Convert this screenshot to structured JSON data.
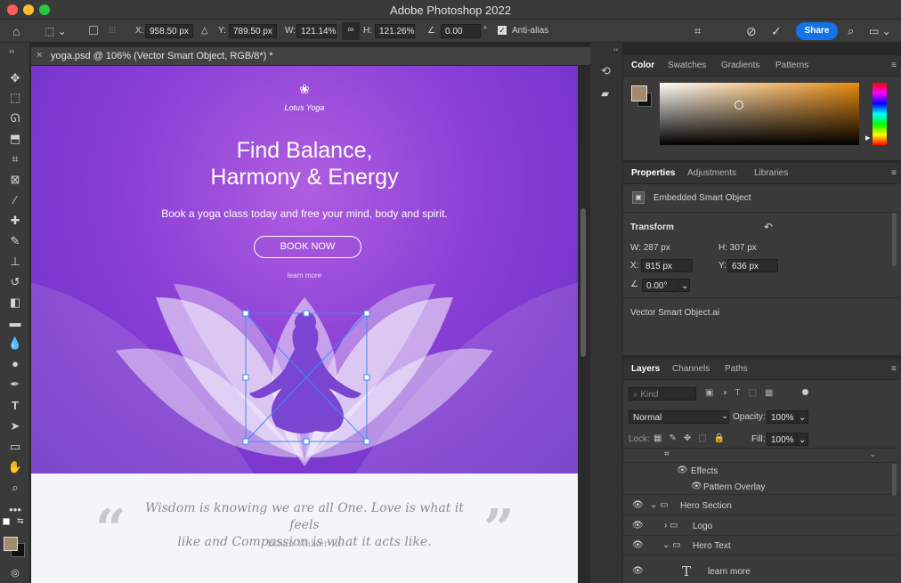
{
  "app": {
    "title": "Adobe Photoshop 2022"
  },
  "options": {
    "x_label": "X:",
    "x_value": "958.50 px",
    "y_label": "Y:",
    "y_value": "789.50 px",
    "w_label": "W:",
    "w_value": "121.14%",
    "h_label": "H:",
    "h_value": "121.26%",
    "angle_value": "0.00",
    "angle_unit": "°",
    "antialias_label": "Anti-alias",
    "share_label": "Share"
  },
  "document": {
    "tab_title": "yoga.psd @ 106% (Vector Smart Object, RGB/8*) *"
  },
  "canvas": {
    "logo_name": "Lotus Yoga",
    "heading_line1": "Find Balance,",
    "heading_line2": "Harmony & Energy",
    "subheading": "Book a yoga class today and free your mind, body and spirit.",
    "cta": "BOOK NOW",
    "learn_more": "learn more",
    "quote_line1": "Wisdom is knowing we are all One. Love is what it feels",
    "quote_line2": "like and Compassion is what it acts like.",
    "quote_author": "- Ethan Walker III -",
    "open_quote": "“",
    "close_quote": "”"
  },
  "color_panel": {
    "tabs": [
      "Color",
      "Swatches",
      "Gradients",
      "Patterns"
    ],
    "foreground": "#a58a6e",
    "background": "#111111"
  },
  "properties_panel": {
    "tabs": [
      "Properties",
      "Adjustments",
      "Libraries"
    ],
    "object_type": "Embedded Smart Object",
    "transform_label": "Transform",
    "w": "W:  287 px",
    "h": "H:  307 px",
    "x_label": "X:",
    "x_value": "815 px",
    "y_label": "Y:",
    "y_value": "636 px",
    "angle_value": "0.00°",
    "filename": "Vector Smart Object.ai"
  },
  "layers_panel": {
    "tabs": [
      "Layers",
      "Channels",
      "Paths"
    ],
    "kind_placeholder": "Kind",
    "blend_mode": "Normal",
    "opacity_label": "Opacity:",
    "opacity_value": "100%",
    "lock_label": "Lock:",
    "fill_label": "Fill:",
    "fill_value": "100%",
    "layers": [
      "Effects",
      "Pattern Overlay",
      "Hero Section",
      "Logo",
      "Hero Text",
      "learn more"
    ]
  }
}
